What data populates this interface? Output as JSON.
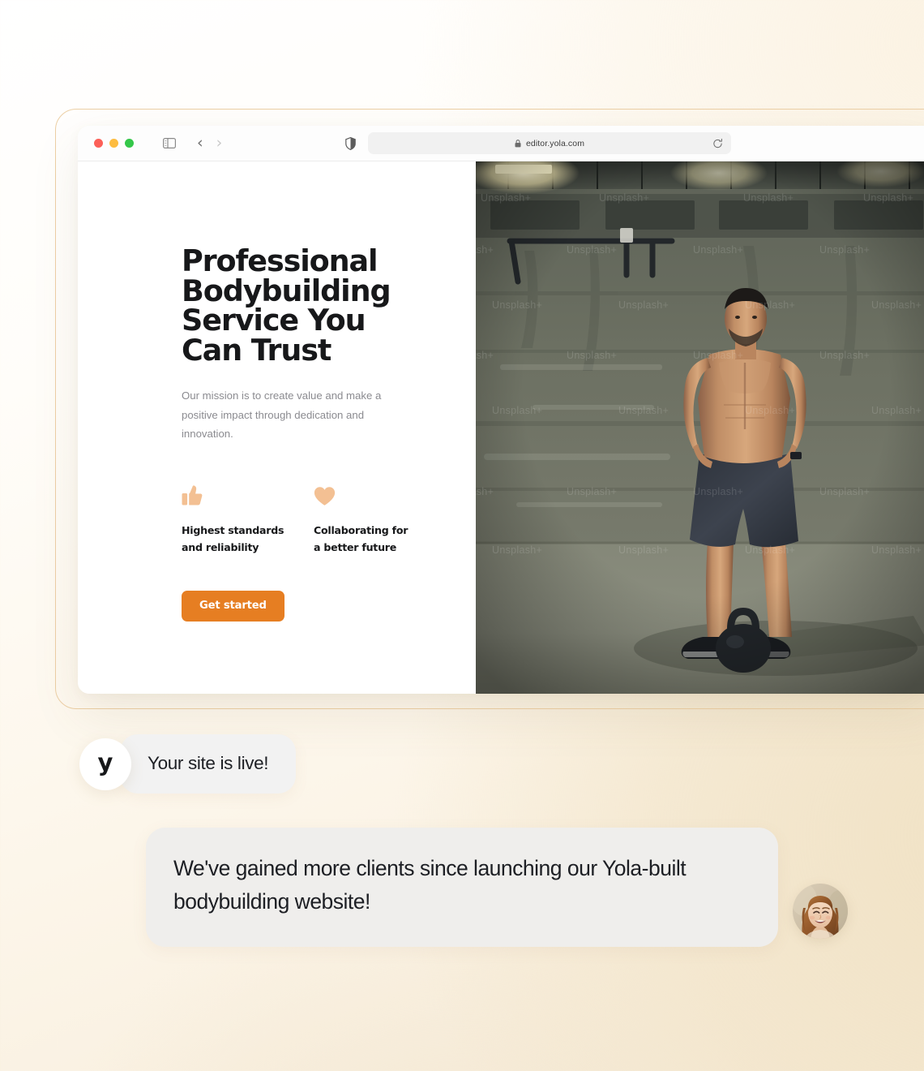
{
  "browser": {
    "traffic_lights": [
      "close",
      "minimize",
      "maximize"
    ],
    "sidebar_icon": "sidebar-toggle-icon",
    "back_icon": "‹",
    "forward_icon": "›",
    "shield_icon": "shield-icon",
    "lock_icon": "lock-icon",
    "address": "editor.yola.com",
    "reload_icon": "reload-icon"
  },
  "site": {
    "headline": "Professional\nBodybuilding\nService You\nCan Trust",
    "subtext": "Our mission is to create value and make a positive impact through dedication and innovation.",
    "features": [
      {
        "icon": "thumbs-up-icon",
        "label": "Highest standards\nand reliability"
      },
      {
        "icon": "heart-icon",
        "label": "Collaborating for\na better future"
      }
    ],
    "cta_label": "Get started",
    "photo_alt": "bodybuilder-standing-in-gym-with-kettlebell",
    "photo_watermark": "Unsplash+"
  },
  "chat": {
    "brand_letter": "y",
    "status_message": "Your site is live!",
    "testimonial": "We've gained more clients since launching our Yola-built bodybuilding website!",
    "client_avatar": "smiling-woman-portrait"
  },
  "colors": {
    "accent_orange": "#e67e22",
    "feature_icon_peach": "#f3c093",
    "frame_outline": "#eccfa5",
    "background_cream": "#f0e1c3",
    "bubble_gray": "#f2f2f2",
    "bubble_gray_alt": "#efeeec",
    "text_dark": "#17181a",
    "text_muted": "#8b8b90"
  }
}
